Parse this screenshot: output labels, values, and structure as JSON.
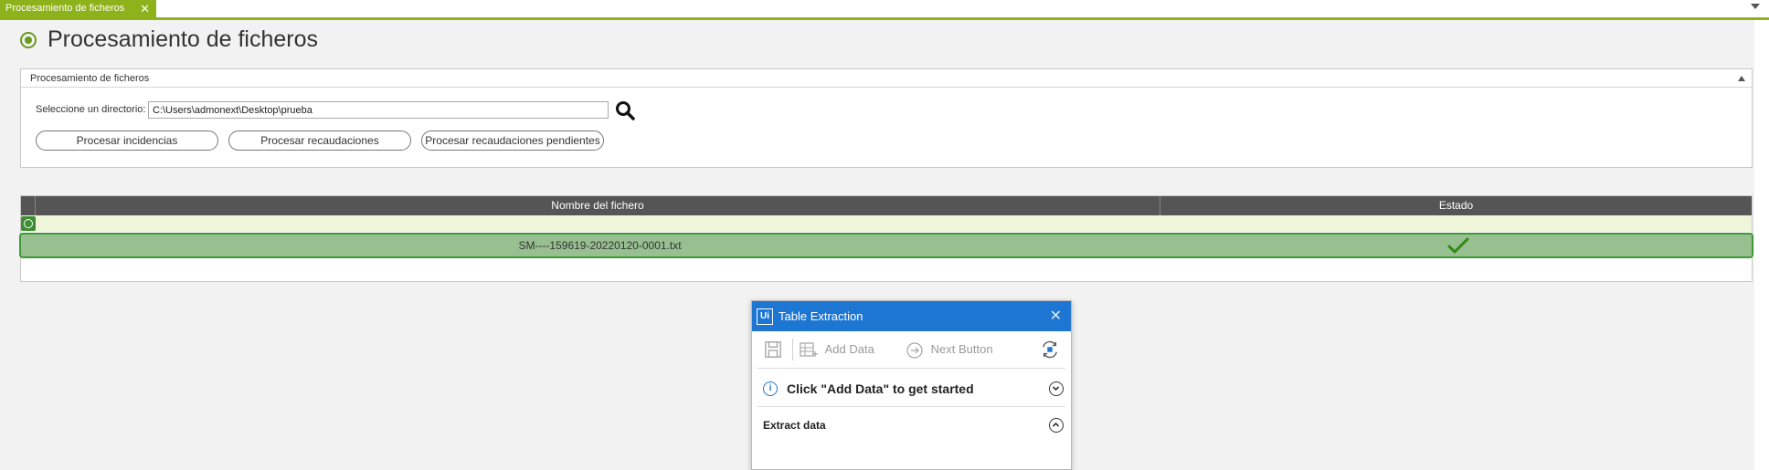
{
  "tab": {
    "label": "Procesamiento de ficheros",
    "close_glyph": "✕"
  },
  "page": {
    "title": "Procesamiento de ficheros"
  },
  "panel": {
    "title": "Procesamiento de ficheros",
    "directory_label": "Seleccione un directorio:",
    "directory_value": "C:\\Users\\admonext\\Desktop\\prueba",
    "buttons": {
      "incidencias": "Procesar incidencias",
      "recaudaciones": "Procesar recaudaciones",
      "pendientes": "Procesar recaudaciones pendientes"
    }
  },
  "grid": {
    "columns": [
      "Nombre del fichero",
      "Estado"
    ],
    "rows": [
      {
        "file_name": "SM----159619-20220120-0001.txt",
        "status": "ok"
      }
    ]
  },
  "dialog": {
    "title": "Table Extraction",
    "logo_text": "Ui",
    "close_glyph": "✕",
    "toolbar": {
      "add_data": "Add Data",
      "next_button": "Next Button"
    },
    "hint": "Click \"Add Data\" to get started",
    "info_glyph": "i",
    "section": "Extract data"
  },
  "colors": {
    "accent": "#8db21b",
    "row_selected": "#97bf90",
    "row_border": "#3e9a39",
    "dialog_blue": "#1d76d2",
    "header_dark": "#555555"
  }
}
